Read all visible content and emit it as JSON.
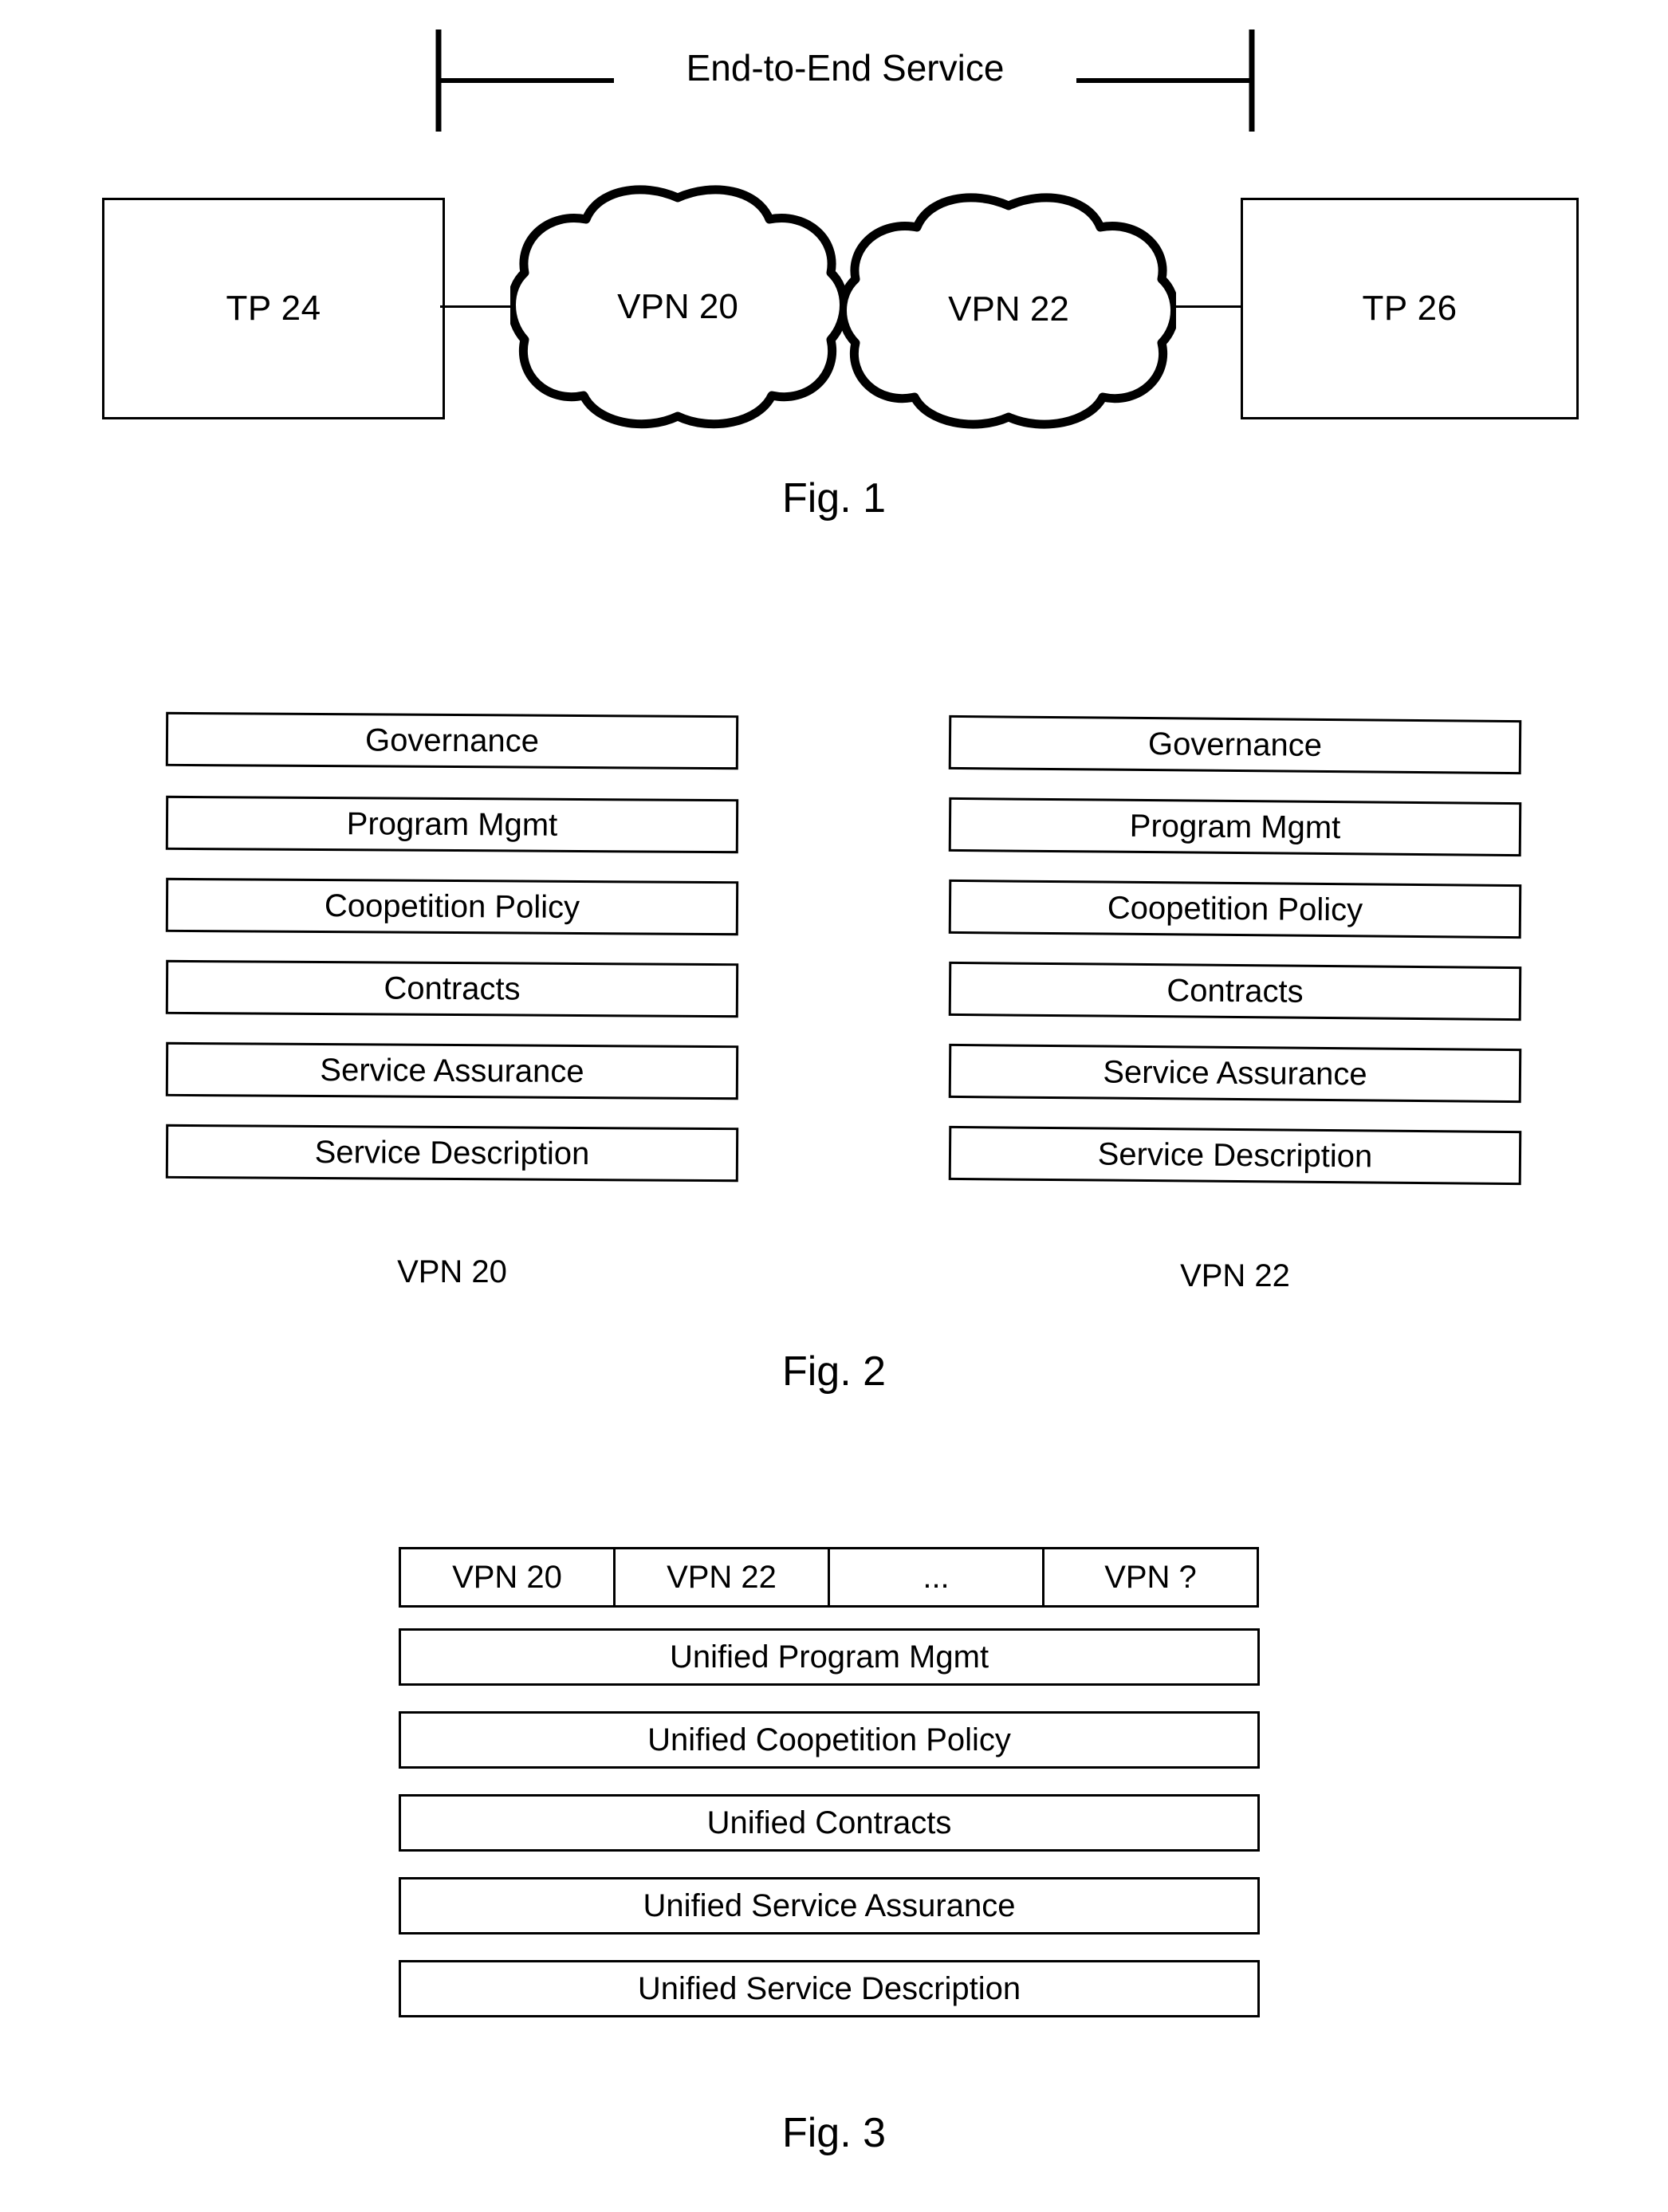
{
  "figures": [
    {
      "id": "fig1",
      "caption": "Fig. 1",
      "bracket_label": "End-to-End Service",
      "nodes": {
        "left_box": "TP 24",
        "right_box": "TP 26",
        "cloud_left": "VPN 20",
        "cloud_right": "VPN 22"
      }
    },
    {
      "id": "fig2",
      "caption": "Fig. 2",
      "columns": [
        {
          "label": "VPN 20",
          "layers": [
            "Governance",
            "Program Mgmt",
            "Coopetition Policy",
            "Contracts",
            "Service Assurance",
            "Service Description"
          ]
        },
        {
          "label": "VPN 22",
          "layers": [
            "Governance",
            "Program Mgmt",
            "Coopetition Policy",
            "Contracts",
            "Service Assurance",
            "Service Description"
          ]
        }
      ]
    },
    {
      "id": "fig3",
      "caption": "Fig. 3",
      "top_row": [
        "VPN 20",
        "VPN 22",
        "...",
        "VPN ?"
      ],
      "layers": [
        "Unified Program Mgmt",
        "Unified Coopetition Policy",
        "Unified Contracts",
        "Unified Service Assurance",
        "Unified Service Description"
      ]
    }
  ]
}
